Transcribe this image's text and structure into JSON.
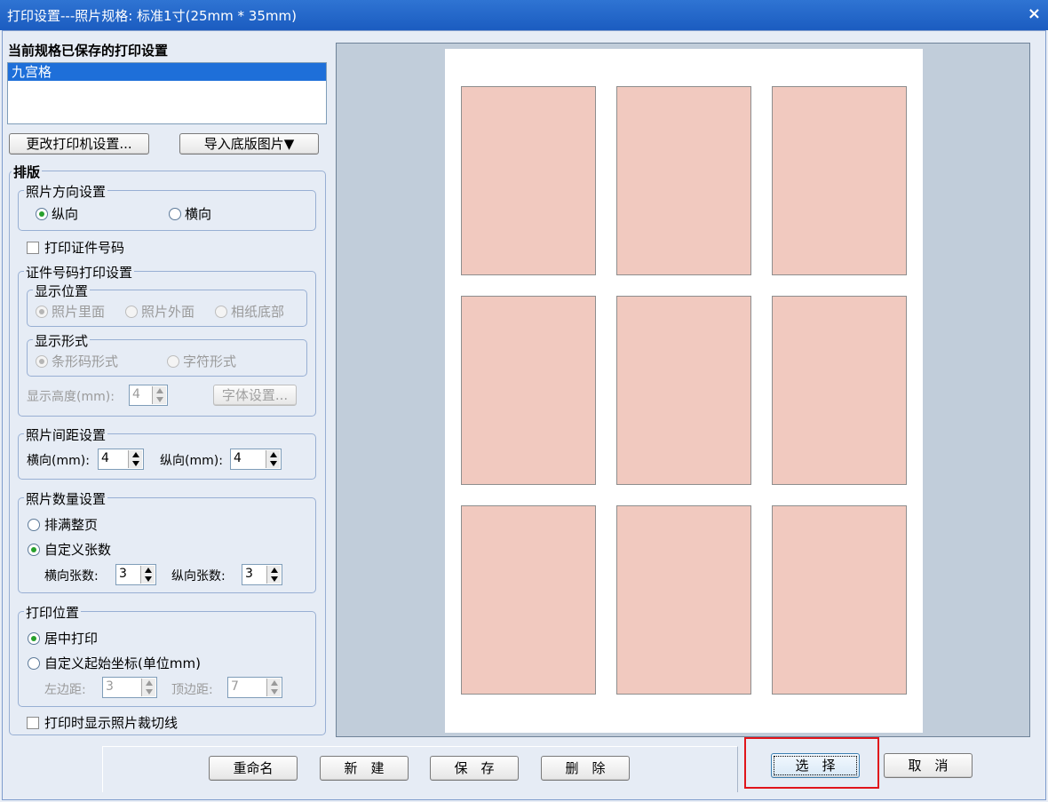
{
  "window": {
    "title": "打印设置---照片规格: 标准1寸(25mm * 35mm)",
    "close": "×"
  },
  "saved": {
    "label": "当前规格已保存的打印设置",
    "items": [
      "九宫格"
    ]
  },
  "buttons": {
    "printer": "更改打印机设置...",
    "import": "导入底版图片▼",
    "font": "字体设置...",
    "rename": "重命名",
    "new": "新　建",
    "save": "保　存",
    "delete": "删　除",
    "select": "选　择",
    "cancel": "取　消"
  },
  "layout": {
    "title": "排版"
  },
  "orientation": {
    "title": "照片方向设置",
    "portrait": "纵向",
    "landscape": "横向",
    "selected": "portrait"
  },
  "print_id": {
    "label": "打印证件号码",
    "checked": false
  },
  "id_settings": {
    "title": "证件号码打印设置",
    "position": {
      "title": "显示位置",
      "inside": "照片里面",
      "outside": "照片外面",
      "bottom": "相纸底部"
    },
    "form": {
      "title": "显示形式",
      "barcode": "条形码形式",
      "chars": "字符形式"
    },
    "height_label": "显示高度(mm):",
    "height_value": "4"
  },
  "spacing": {
    "title": "照片间距设置",
    "h_label": "横向(mm):",
    "h_value": "4",
    "v_label": "纵向(mm):",
    "v_value": "4"
  },
  "count": {
    "title": "照片数量设置",
    "fill": "排满整页",
    "custom": "自定义张数",
    "cols_label": "横向张数:",
    "cols_value": "3",
    "rows_label": "纵向张数:",
    "rows_value": "3"
  },
  "print_pos": {
    "title": "打印位置",
    "center": "居中打印",
    "custom": "自定义起始坐标(单位mm)",
    "left_label": "左边距:",
    "left_value": "3",
    "top_label": "顶边距:",
    "top_value": "7"
  },
  "cut_lines": {
    "label": "打印时显示照片裁切线",
    "checked": false
  },
  "preview": {
    "rows": 3,
    "cols": 3,
    "photo_color": "#f1c9bf",
    "paper_color": "#ffffff",
    "bg_color": "#c1cdda"
  },
  "colors": {
    "title_bar": "#2f74d3",
    "selection": "#1e6fd9",
    "highlight": "#e0151b"
  }
}
